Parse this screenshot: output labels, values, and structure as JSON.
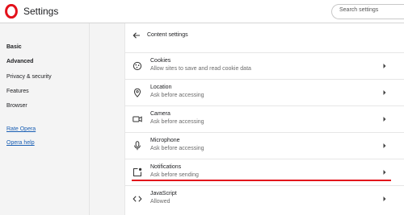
{
  "app": {
    "title": "Settings"
  },
  "search": {
    "placeholder": "Search settings"
  },
  "sidebar": {
    "items": [
      {
        "label": "Basic"
      },
      {
        "label": "Advanced"
      },
      {
        "label": "Privacy & security"
      },
      {
        "label": "Features"
      },
      {
        "label": "Browser"
      }
    ],
    "links": [
      {
        "label": "Rate Opera"
      },
      {
        "label": "Opera help"
      }
    ]
  },
  "content": {
    "title": "Content settings",
    "rows": [
      {
        "title": "Cookies",
        "subtitle": "Allow sites to save and read cookie data",
        "icon": "cookie-icon"
      },
      {
        "title": "Location",
        "subtitle": "Ask before accessing",
        "icon": "location-pin-icon"
      },
      {
        "title": "Camera",
        "subtitle": "Ask before accessing",
        "icon": "camera-icon"
      },
      {
        "title": "Microphone",
        "subtitle": "Ask before accessing",
        "icon": "microphone-icon"
      },
      {
        "title": "Notifications",
        "subtitle": "Ask before sending",
        "icon": "notification-icon"
      },
      {
        "title": "JavaScript",
        "subtitle": "Allowed",
        "icon": "code-icon"
      }
    ]
  },
  "colors": {
    "brand": "#e3111b",
    "link": "#1a5fb4",
    "highlight_underline": "#e3111b"
  }
}
